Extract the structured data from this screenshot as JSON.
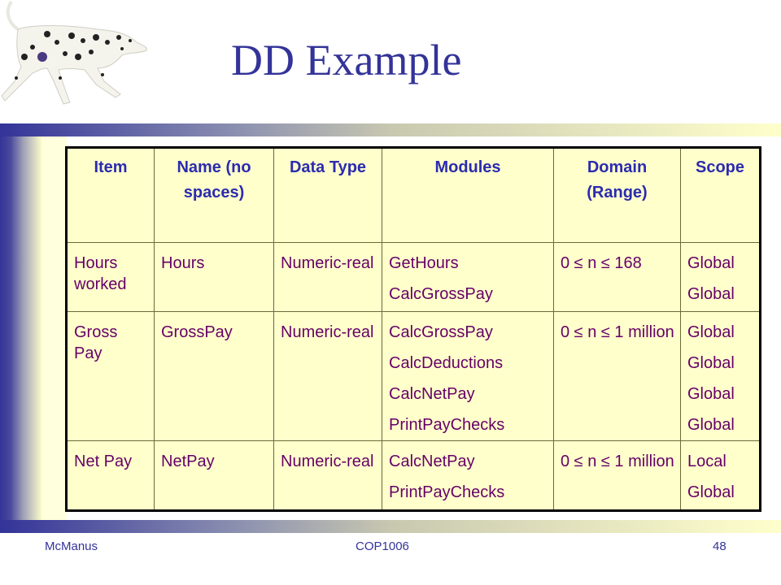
{
  "slide": {
    "title": "DD Example",
    "image_icon": "dalmatian-dog-icon"
  },
  "table": {
    "headers": [
      "Item",
      "Name (no spaces)",
      "Data Type",
      "Modules",
      "Domain (Range)",
      "Scope"
    ],
    "rows": [
      {
        "item": "Hours worked",
        "name": "Hours",
        "data_type": "Numeric-real",
        "modules": [
          "GetHours",
          "CalcGrossPay"
        ],
        "domain": "0 ≤ n ≤ 168",
        "scope": [
          "Global",
          "Global"
        ]
      },
      {
        "item": "Gross Pay",
        "name": "GrossPay",
        "data_type": "Numeric-real",
        "modules": [
          "CalcGrossPay",
          "CalcDeductions",
          "CalcNetPay",
          "PrintPayChecks"
        ],
        "domain": "0 ≤ n ≤ 1 million",
        "scope": [
          "Global",
          "Global",
          "Global",
          "Global"
        ]
      },
      {
        "item": "Net Pay",
        "name": "NetPay",
        "data_type": "Numeric-real",
        "modules": [
          "CalcNetPay",
          "PrintPayChecks"
        ],
        "domain": "0 ≤ n ≤ 1 million",
        "scope": [
          "Local",
          "Global"
        ]
      }
    ]
  },
  "footer": {
    "author": "McManus",
    "course": "COP1006",
    "page_number": "48"
  },
  "colors": {
    "title": "#333399",
    "header_text": "#2b2bb0",
    "cell_text": "#660066",
    "table_bg": "#ffffcc",
    "gradient_start": "#333399",
    "gradient_end": "#ffffcc"
  }
}
